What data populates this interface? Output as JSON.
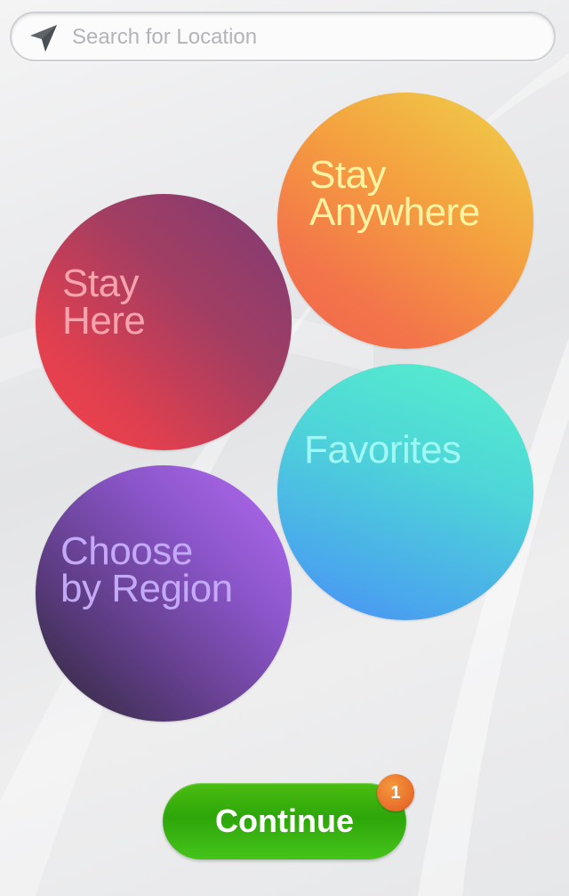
{
  "search": {
    "placeholder": "Search for Location",
    "icon": "location-arrow-icon"
  },
  "bubbles": {
    "stay_here": {
      "line1": "Stay",
      "line2": "Here",
      "text_color": "#f7a3ad"
    },
    "stay_anywhere": {
      "line1": "Stay",
      "line2": "Anywhere",
      "text_color": "#fdf3a0"
    },
    "favorites": {
      "label": "Favorites",
      "text_color": "#a2f7f3"
    },
    "choose_region": {
      "line1": "Choose",
      "line2": "by Region",
      "text_color": "#c3a9f7"
    }
  },
  "continue_button": {
    "label": "Continue",
    "badge_count": "1"
  },
  "colors": {
    "continue_green": "#3db20f",
    "badge_orange": "#e8702c"
  }
}
